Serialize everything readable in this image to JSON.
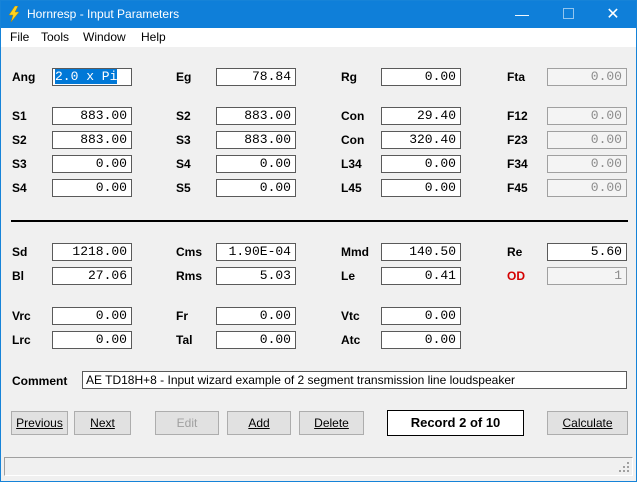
{
  "window": {
    "title": "Hornresp - Input Parameters"
  },
  "menu": [
    "File",
    "Tools",
    "Window",
    "Help"
  ],
  "rows1": [
    [
      {
        "l": "Ang",
        "v": "2.0 x Pi"
      },
      {
        "l": "Eg",
        "v": "78.84"
      },
      {
        "l": "Rg",
        "v": "0.00"
      },
      {
        "l": "Fta",
        "v": "0.00"
      }
    ]
  ],
  "rows2": [
    [
      {
        "l": "S1",
        "v": "883.00"
      },
      {
        "l": "S2",
        "v": "883.00"
      },
      {
        "l": "Con",
        "v": "29.40"
      },
      {
        "l": "F12",
        "v": "0.00"
      }
    ],
    [
      {
        "l": "S2",
        "v": "883.00"
      },
      {
        "l": "S3",
        "v": "883.00"
      },
      {
        "l": "Con",
        "v": "320.40"
      },
      {
        "l": "F23",
        "v": "0.00"
      }
    ],
    [
      {
        "l": "S3",
        "v": "0.00"
      },
      {
        "l": "S4",
        "v": "0.00"
      },
      {
        "l": "L34",
        "v": "0.00"
      },
      {
        "l": "F34",
        "v": "0.00"
      }
    ],
    [
      {
        "l": "S4",
        "v": "0.00"
      },
      {
        "l": "S5",
        "v": "0.00"
      },
      {
        "l": "L45",
        "v": "0.00"
      },
      {
        "l": "F45",
        "v": "0.00"
      }
    ]
  ],
  "rows3": [
    [
      {
        "l": "Sd",
        "v": "1218.00"
      },
      {
        "l": "Cms",
        "v": "1.90E-04"
      },
      {
        "l": "Mmd",
        "v": "140.50"
      },
      {
        "l": "Re",
        "v": "5.60"
      }
    ],
    [
      {
        "l": "Bl",
        "v": "27.06"
      },
      {
        "l": "Rms",
        "v": "5.03"
      },
      {
        "l": "Le",
        "v": "0.41"
      },
      {
        "l": "OD",
        "v": "1"
      }
    ]
  ],
  "rows4": [
    [
      {
        "l": "Vrc",
        "v": "0.00"
      },
      {
        "l": "Fr",
        "v": "0.00"
      },
      {
        "l": "Vtc",
        "v": "0.00"
      }
    ],
    [
      {
        "l": "Lrc",
        "v": "0.00"
      },
      {
        "l": "Tal",
        "v": "0.00"
      },
      {
        "l": "Atc",
        "v": "0.00"
      }
    ]
  ],
  "comment": {
    "label": "Comment",
    "value": "AE TD18H+8 - Input wizard example of 2 segment transmission line loudspeaker"
  },
  "buttons": {
    "previous": "Previous",
    "next": "Next",
    "edit": "Edit",
    "add": "Add",
    "delete": "Delete",
    "calculate": "Calculate"
  },
  "record": "Record 2 of 10",
  "colors": {
    "titlebar": "#0f7fd9",
    "od_label": "#d40000",
    "selection": "#0078d7"
  }
}
